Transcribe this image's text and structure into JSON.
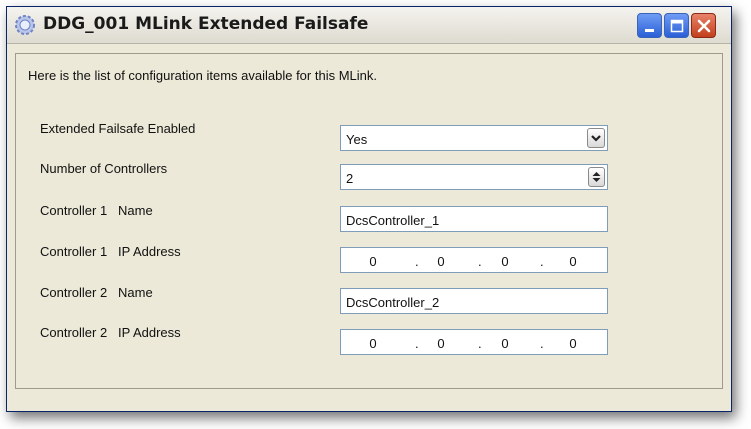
{
  "window": {
    "title": "DDG_001 MLink Extended Failsafe"
  },
  "intro_text": "Here is the list of configuration items available for this MLink.",
  "rows": {
    "failsafe_enabled": {
      "label": "Extended Failsafe Enabled",
      "value": "Yes"
    },
    "num_controllers": {
      "label": "Number of Controllers",
      "value": "2"
    },
    "ctrl1_name": {
      "label": "Controller 1   Name",
      "value": "DcsController_1"
    },
    "ctrl1_ip": {
      "label": "Controller 1   IP Address",
      "octets": [
        "0",
        "0",
        "0",
        "0"
      ]
    },
    "ctrl2_name": {
      "label": "Controller 2   Name",
      "value": "DcsController_2"
    },
    "ctrl2_ip": {
      "label": "Controller 2   IP Address",
      "octets": [
        "0",
        "0",
        "0",
        "0"
      ]
    }
  },
  "ip_separator": ".",
  "icons": {
    "app": "gear-icon",
    "minimize": "minimize-icon",
    "maximize": "maximize-icon",
    "close": "close-icon",
    "dropdown": "chevron-down-icon",
    "spinner": "spinner-arrows-icon"
  },
  "colors": {
    "window_bg": "#ece9d8",
    "title_button_blue": "#2b5fd6",
    "close_button_red": "#c23e1c",
    "field_border": "#7f9db9"
  }
}
